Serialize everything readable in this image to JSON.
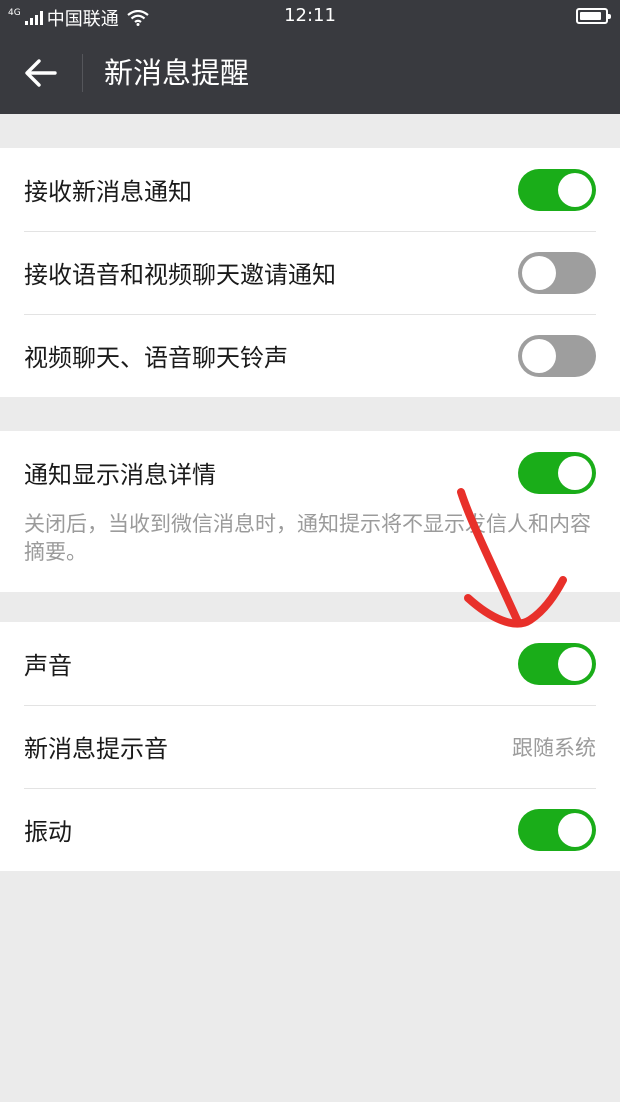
{
  "status_bar": {
    "network": "4G",
    "carrier": "中国联通",
    "time": "12:11",
    "battery_level": 0.8
  },
  "header": {
    "back_icon": "arrow-left-icon",
    "title": "新消息提醒"
  },
  "colors": {
    "header_bg": "#393a3f",
    "toggle_on": "#1aad19",
    "toggle_off": "#9e9e9e",
    "page_bg": "#ebebeb",
    "annotation": "#e8302a"
  },
  "section1": {
    "items": [
      {
        "label": "接收新消息通知",
        "on": true
      },
      {
        "label": "接收语音和视频聊天邀请通知",
        "on": false
      },
      {
        "label": "视频聊天、语音聊天铃声",
        "on": false
      }
    ]
  },
  "section2": {
    "item": {
      "label": "通知显示消息详情",
      "on": true
    },
    "description": "关闭后，当收到微信消息时，通知提示将不显示发信人和内容摘要。"
  },
  "section3": {
    "items": [
      {
        "label": "声音",
        "on": true
      },
      {
        "label": "新消息提示音",
        "value": "跟随系统"
      },
      {
        "label": "振动",
        "on": true
      }
    ]
  }
}
